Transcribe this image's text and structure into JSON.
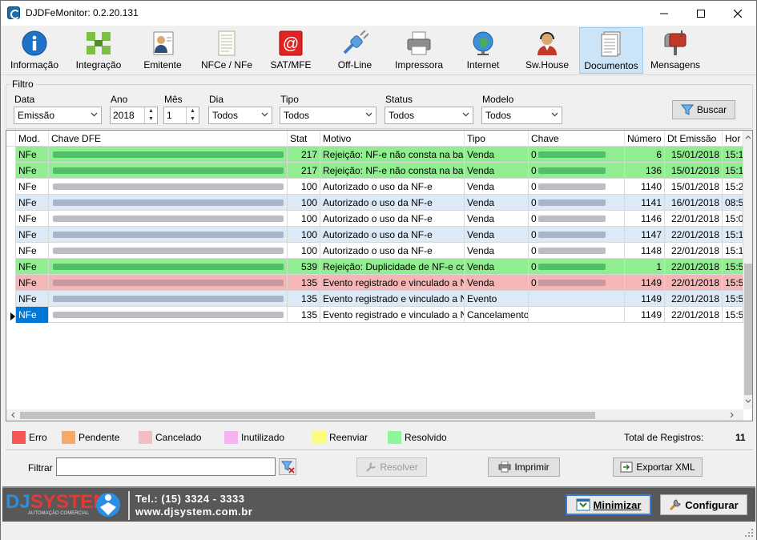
{
  "window": {
    "title": "DJDFeMonitor: 0.2.20.131"
  },
  "toolbar": {
    "items": [
      {
        "label": "Informação",
        "icon": "info-icon"
      },
      {
        "label": "Integração",
        "icon": "integration-icon"
      },
      {
        "label": "Emitente",
        "icon": "issuer-icon"
      },
      {
        "label": "NFCe / NFe",
        "icon": "document-icon"
      },
      {
        "label": "SAT/MFE",
        "icon": "email-at-icon"
      },
      {
        "label": "Off-Line",
        "icon": "offline-plug-icon"
      },
      {
        "label": "Impressora",
        "icon": "printer-icon"
      },
      {
        "label": "Internet",
        "icon": "globe-icon"
      },
      {
        "label": "Sw.House",
        "icon": "support-headset-icon"
      },
      {
        "label": "Documentos",
        "icon": "documents-icon"
      },
      {
        "label": "Mensagens",
        "icon": "mailbox-icon"
      }
    ]
  },
  "filter": {
    "title": "Filtro",
    "data_label": "Data",
    "data_value": "Emissão",
    "ano_label": "Ano",
    "ano_value": "2018",
    "mes_label": "Mês",
    "mes_value": "1",
    "dia_label": "Dia",
    "dia_value": "Todos",
    "tipo_label": "Tipo",
    "tipo_value": "Todos",
    "status_label": "Status",
    "status_value": "Todos",
    "modelo_label": "Modelo",
    "modelo_value": "Todos",
    "search_label": "Buscar"
  },
  "grid": {
    "columns": [
      "Mod.",
      "Chave DFE",
      "Stat",
      "Motivo",
      "Tipo",
      "Chave",
      "Número",
      "Dt Emissão",
      "Hor"
    ],
    "rows": [
      {
        "mod": "NFe",
        "stat": "217",
        "motivo": "Rejeição: NF-e não consta na bas",
        "tipo": "Venda",
        "chave": "0",
        "numero": "6",
        "data": "15/01/2018",
        "hora": "15:1",
        "color": "g"
      },
      {
        "mod": "NFe",
        "stat": "217",
        "motivo": "Rejeição: NF-e não consta na bas",
        "tipo": "Venda",
        "chave": "0",
        "numero": "136",
        "data": "15/01/2018",
        "hora": "15:1",
        "color": "g"
      },
      {
        "mod": "NFe",
        "stat": "100",
        "motivo": "Autorizado o uso da NF-e",
        "tipo": "Venda",
        "chave": "0",
        "numero": "1140",
        "data": "15/01/2018",
        "hora": "15:2",
        "color": "w"
      },
      {
        "mod": "NFe",
        "stat": "100",
        "motivo": "Autorizado o uso da NF-e",
        "tipo": "Venda",
        "chave": "0",
        "numero": "1141",
        "data": "16/01/2018",
        "hora": "08:5",
        "color": "b"
      },
      {
        "mod": "NFe",
        "stat": "100",
        "motivo": "Autorizado o uso da NF-e",
        "tipo": "Venda",
        "chave": "0",
        "numero": "1146",
        "data": "22/01/2018",
        "hora": "15:0",
        "color": "w"
      },
      {
        "mod": "NFe",
        "stat": "100",
        "motivo": "Autorizado o uso da NF-e",
        "tipo": "Venda",
        "chave": "0",
        "numero": "1147",
        "data": "22/01/2018",
        "hora": "15:1",
        "color": "b"
      },
      {
        "mod": "NFe",
        "stat": "100",
        "motivo": "Autorizado o uso da NF-e",
        "tipo": "Venda",
        "chave": "0",
        "numero": "1148",
        "data": "22/01/2018",
        "hora": "15:1",
        "color": "w"
      },
      {
        "mod": "NFe",
        "stat": "539",
        "motivo": "Rejeição: Duplicidade de NF-e co",
        "tipo": "Venda",
        "chave": "0",
        "numero": "1",
        "data": "22/01/2018",
        "hora": "15:5",
        "color": "g"
      },
      {
        "mod": "NFe",
        "stat": "135",
        "motivo": "Evento registrado e vinculado a N",
        "tipo": "Venda",
        "chave": "0",
        "numero": "1149",
        "data": "22/01/2018",
        "hora": "15:5",
        "color": "r"
      },
      {
        "mod": "NFe",
        "stat": "135",
        "motivo": "Evento registrado e vinculado a N",
        "tipo": "Evento",
        "chave": "",
        "numero": "1149",
        "data": "22/01/2018",
        "hora": "15:5",
        "color": "b"
      },
      {
        "mod": "NFe",
        "stat": "135",
        "motivo": "Evento registrado e vinculado a N",
        "tipo": "Cancelamento",
        "chave": "",
        "numero": "1149",
        "data": "22/01/2018",
        "hora": "15:5",
        "color": "w"
      }
    ]
  },
  "legend": {
    "items": [
      {
        "label": "Erro",
        "color": "#f75454"
      },
      {
        "label": "Pendente",
        "color": "#f9a967"
      },
      {
        "label": "Cancelado",
        "color": "#f5bebe"
      },
      {
        "label": "Inutilizado",
        "color": "#f5b4f1"
      },
      {
        "label": "Reenviar",
        "color": "#fbfb7c"
      },
      {
        "label": "Resolvido",
        "color": "#8ff59a"
      }
    ],
    "total_label": "Total de Registros:",
    "total_value": "11"
  },
  "actions": {
    "filter_label": "Filtrar",
    "filter_value": "",
    "resolver": "Resolver",
    "imprimir": "Imprimir",
    "exportar": "Exportar XML"
  },
  "footer": {
    "brand_dj": "DJ",
    "brand_system": "SYSTEM",
    "brand_sub": "AUTOMAÇÃO COMERCIAL",
    "phone": "Tel.: (15) 3324 - 3333",
    "site": "www.djsystem.com.br",
    "minimize": "Minimizar",
    "configure": "Configurar"
  }
}
